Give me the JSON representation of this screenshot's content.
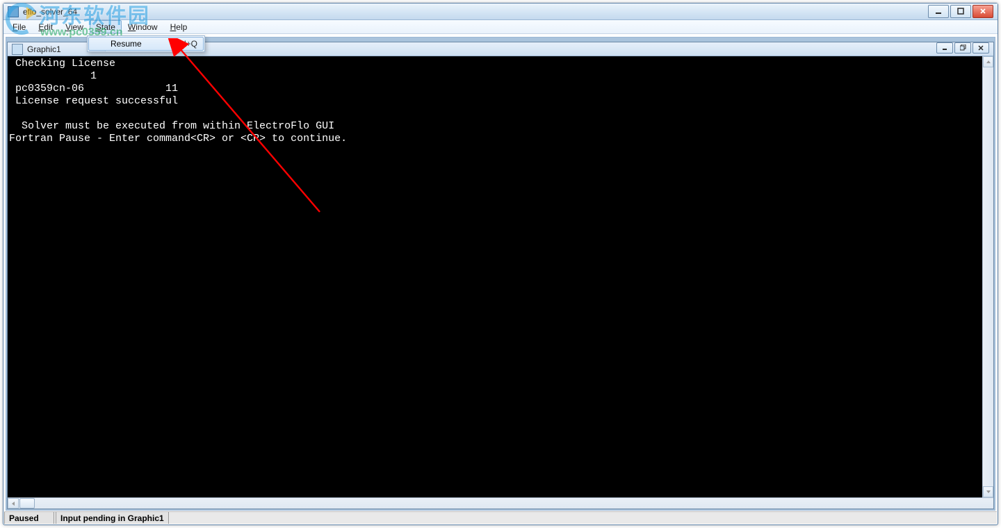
{
  "outer": {
    "title": "eflo_solver_64",
    "buttons": {
      "min": "minimize",
      "max": "maximize",
      "close": "close"
    }
  },
  "menubar": {
    "items": [
      {
        "label": "File",
        "mn": "F"
      },
      {
        "label": "Edit",
        "mn": "E"
      },
      {
        "label": "View",
        "mn": "V"
      },
      {
        "label": "State",
        "mn": "S",
        "active": true
      },
      {
        "label": "Window",
        "mn": "W"
      },
      {
        "label": "Help",
        "mn": "H"
      }
    ]
  },
  "dropdown": {
    "items": [
      {
        "label": "Resume",
        "shortcut": "Ctrl+Q",
        "highlight": true
      }
    ]
  },
  "child": {
    "title": "Graphic1"
  },
  "console_lines": [
    " Checking License",
    "             1",
    " pc0359cn-06             11",
    " License request successful",
    "",
    "  Solver must be executed from within ElectroFlo GUI",
    "Fortran Pause - Enter command<CR> or <CR> to continue."
  ],
  "statusbar": {
    "state": "Paused",
    "msg": "Input pending in Graphic1"
  },
  "watermark": {
    "cn": "河东软件园",
    "url": "www.pc0359.cn"
  }
}
